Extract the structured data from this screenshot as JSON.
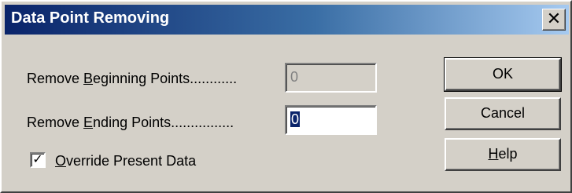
{
  "dialog": {
    "title": "Data Point Removing",
    "close_glyph": "✕"
  },
  "form": {
    "beginning": {
      "label_pre": "Remove ",
      "label_mnemonic": "B",
      "label_post": "eginning Points............",
      "value": "0",
      "enabled": false
    },
    "ending": {
      "label_pre": "Remove ",
      "label_mnemonic": "E",
      "label_post": "nding Points................",
      "value": "0",
      "enabled": true
    },
    "override": {
      "label_mnemonic": "O",
      "label_post": "verride Present Data",
      "checked": true,
      "check_glyph": "✓"
    }
  },
  "buttons": {
    "ok": "OK",
    "cancel": "Cancel",
    "help_mnemonic": "H",
    "help_post": "elp"
  },
  "colors": {
    "face": "#d4d0c8",
    "title_start": "#0a246a",
    "title_end": "#a6caf0",
    "selection": "#0a246a"
  }
}
